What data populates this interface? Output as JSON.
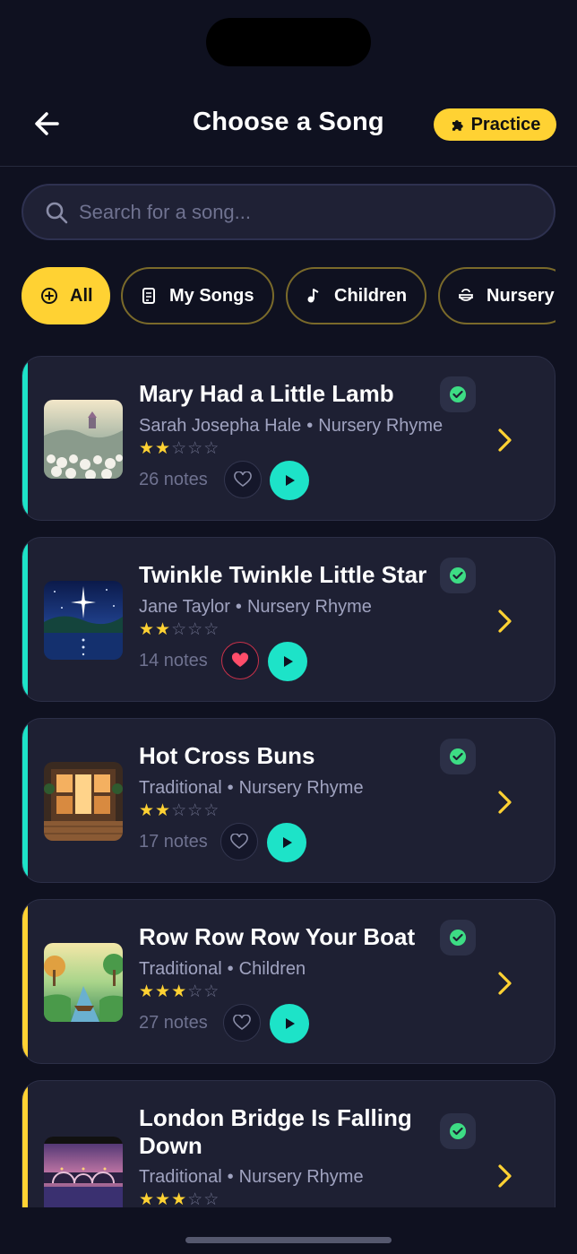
{
  "header": {
    "title": "Choose a Song",
    "practice_label": "Practice"
  },
  "search": {
    "placeholder": "Search for a song..."
  },
  "filters": [
    {
      "label": "All",
      "icon": "plus-circle-icon",
      "active": true
    },
    {
      "label": "My Songs",
      "icon": "document-icon",
      "active": false
    },
    {
      "label": "Children",
      "icon": "music-note-icon",
      "active": false
    },
    {
      "label": "Nursery",
      "icon": "bowl-icon",
      "active": false
    }
  ],
  "songs": [
    {
      "title": "Mary Had a Little Lamb",
      "author": "Sarah Josepha Hale",
      "category": "Nursery Rhyme",
      "rating": 2,
      "notes": "26 notes",
      "favorite": false,
      "completed": true,
      "accent": "#1de3c8",
      "thumbnail": "meadow-with-castle"
    },
    {
      "title": "Twinkle Twinkle Little Star",
      "author": "Jane Taylor",
      "category": "Nursery Rhyme",
      "rating": 2,
      "notes": "14 notes",
      "favorite": true,
      "completed": true,
      "accent": "#1de3c8",
      "thumbnail": "starry-lake-night"
    },
    {
      "title": "Hot Cross Buns",
      "author": "Traditional",
      "category": "Nursery Rhyme",
      "rating": 2,
      "notes": "17 notes",
      "favorite": false,
      "completed": true,
      "accent": "#1de3c8",
      "thumbnail": "bakery-window"
    },
    {
      "title": "Row Row Row Your Boat",
      "author": "Traditional",
      "category": "Children",
      "rating": 3,
      "notes": "27 notes",
      "favorite": false,
      "completed": true,
      "accent": "#ffd233",
      "thumbnail": "boat-on-river"
    },
    {
      "title": "London Bridge Is Falling Down",
      "author": "Traditional",
      "category": "Nursery Rhyme",
      "rating": 3,
      "notes": "",
      "favorite": false,
      "completed": true,
      "accent": "#ffd233",
      "thumbnail": "bridge-at-sunset"
    }
  ],
  "colors": {
    "background": "#0f1120",
    "card": "#1e2033",
    "yellow": "#ffd233",
    "teal": "#1de3c8",
    "heart": "#ff4d6a",
    "check": "#3ddc84"
  }
}
